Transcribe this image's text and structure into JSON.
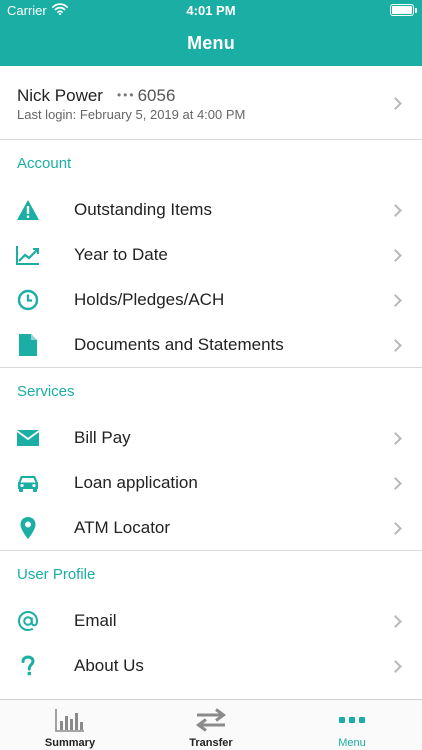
{
  "status_bar": {
    "carrier": "Carrier",
    "time": "4:01 PM"
  },
  "nav": {
    "title": "Menu"
  },
  "profile": {
    "name": "Nick Power",
    "masked_dots": "•••",
    "account_suffix": "6056",
    "last_login": "Last login: February 5, 2019 at 4:00 PM"
  },
  "sections": {
    "account": {
      "title": "Account",
      "items": [
        {
          "label": "Outstanding Items",
          "icon": "warning-icon"
        },
        {
          "label": "Year to Date",
          "icon": "trend-chart-icon"
        },
        {
          "label": "Holds/Pledges/ACH",
          "icon": "clock-icon"
        },
        {
          "label": "Documents and Statements",
          "icon": "document-icon"
        }
      ]
    },
    "services": {
      "title": "Services",
      "items": [
        {
          "label": "Bill Pay",
          "icon": "envelope-icon"
        },
        {
          "label": "Loan application",
          "icon": "car-icon"
        },
        {
          "label": "ATM Locator",
          "icon": "map-pin-icon"
        }
      ]
    },
    "user_profile": {
      "title": "User Profile",
      "items": [
        {
          "label": "Email",
          "icon": "at-sign-icon"
        },
        {
          "label": "About Us",
          "icon": "question-mark-icon"
        }
      ]
    }
  },
  "tabbar": {
    "tabs": [
      {
        "label": "Summary",
        "icon": "bar-chart-icon",
        "active": false
      },
      {
        "label": "Transfer",
        "icon": "transfer-arrows-icon",
        "active": false
      },
      {
        "label": "Menu",
        "icon": "dots-menu-icon",
        "active": true
      }
    ]
  },
  "colors": {
    "accent": "#1aaea5",
    "chevron": "#b8b8b8",
    "divider": "#d9d9d9"
  }
}
